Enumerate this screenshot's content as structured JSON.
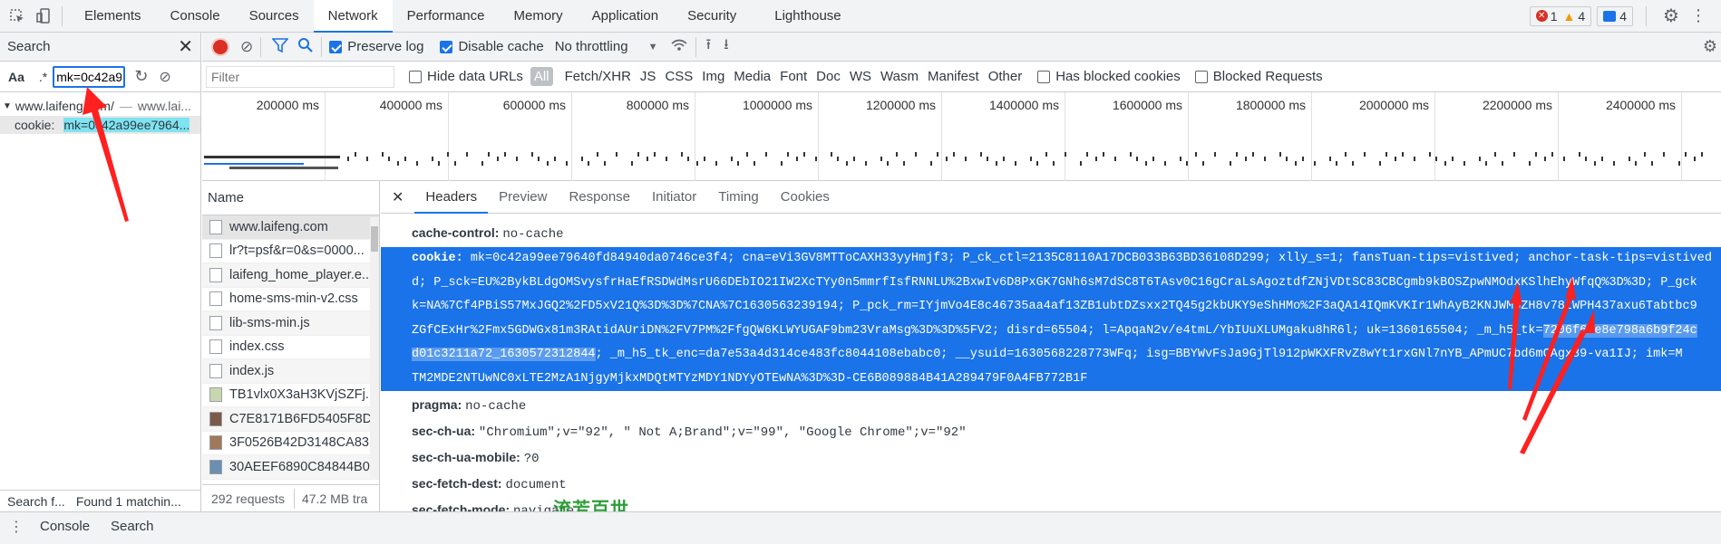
{
  "topbar": {
    "tabs": [
      "Elements",
      "Console",
      "Sources",
      "Network",
      "Performance",
      "Memory",
      "Application",
      "Security",
      "Lighthouse"
    ],
    "active_tab": "Network",
    "errors": "1",
    "warnings": "4",
    "messages": "4"
  },
  "search_panel": {
    "title": "Search",
    "match_case_label": "Aa",
    "regex_label": ".*",
    "query": "mk=0c42a9",
    "result_file": "www.laifeng.com/",
    "result_url": "www.lai...",
    "result_key": "cookie:",
    "result_value": "mk=0c42a99ee7964...",
    "status_left": "Search f...",
    "status_right": "Found 1 matchin..."
  },
  "network_toolbar": {
    "preserve_log": "Preserve log",
    "disable_cache": "Disable cache",
    "throttling": "No throttling"
  },
  "filter_bar": {
    "placeholder": "Filter",
    "hide_data_urls": "Hide data URLs",
    "types": [
      "All",
      "Fetch/XHR",
      "JS",
      "CSS",
      "Img",
      "Media",
      "Font",
      "Doc",
      "WS",
      "Wasm",
      "Manifest",
      "Other"
    ],
    "has_blocked_cookies": "Has blocked cookies",
    "blocked_requests": "Blocked Requests"
  },
  "timeline": {
    "ticks": [
      "200000 ms",
      "400000 ms",
      "600000 ms",
      "800000 ms",
      "1000000 ms",
      "1200000 ms",
      "1400000 ms",
      "1600000 ms",
      "1800000 ms",
      "2000000 ms",
      "2200000 ms",
      "2400000 ms"
    ]
  },
  "request_list": {
    "header": "Name",
    "items": [
      "www.laifeng.com",
      "lr?t=psf&r=0&s=0000...",
      "laifeng_home_player.e...",
      "home-sms-min-v2.css",
      "lib-sms-min.js",
      "index.css",
      "index.js",
      "TB1vlx0X3aH3KVjSZFj...",
      "C7E8171B6FD5405F8D...",
      "3F0526B42D3148CA83...",
      "30AEEF6890C84844B0..."
    ],
    "requests_count": "292 requests",
    "transferred": "47.2 MB tra"
  },
  "detail": {
    "tabs": [
      "Headers",
      "Preview",
      "Response",
      "Initiator",
      "Timing",
      "Cookies"
    ],
    "active_tab": "Headers",
    "cache_control_name": "cache-control:",
    "cache_control_value": "no-cache",
    "cookie_name": "cookie:",
    "cookie_line1": "mk=0c42a99ee79640fd84940da0746ce3f4; cna=eVi3GV8MTToCAXH33yyHmjf3; P_ck_ctl=2135C8110A17DCB033B63BD36108D299; xlly_s=1; fansTuan-tips=vistived; anchor-task-tips=vistived",
    "cookie_line2": "d; P_sck=EU%2BykBLdgOMSvysfrHaEfRSDWdMsrU66DEbIO21IW2XcTYy0n5mmrfIsfRNNLU%2BxwIv6D8PxGK7GNh6sM7dSC8T6TAsv0C16gCraLsAgoztdfZNjVDtSC83CBCgmb9kBOSZpwNMOdxKSlhEhyWfqQ%3D%3D; P_gck",
    "cookie_line3": "k=NA%7Cf4PBiS57MxJGQ2%2FD5xV21Q%3D%3D%7CNA%7C1630563239194; P_pck_rm=IYjmVo4E8c46735aa4af13ZB1ubtDZsxx2TQ45g2kbUKY9eShHMo%2F3aQA14IQmKVKIr1WhAyB2KNJWM3ZH8v78zWPH437axu6Tabtbc9",
    "cookie_line4a": "ZGfCExHr%2Fmx5GDWGx81m3RAtidAUriDN%2FV7PM%2FfgQW6KLWYUGAF9bm23VraMsg%3D%3D%5FV2; disrd=65504; l=ApqaN2v/e4tmL/YbIUuXLUMgaku8hR6l; uk=1360165504; _m_h5_tk=",
    "cookie_line4b": "7206f6ee8e798a6b9f24c",
    "cookie_line5a": "d01c3211a72_1630572312844",
    "cookie_line5b": "; _m_h5_tk_enc=da7e53a4d314ce483fc8044108ebabc0; __ysuid=1630568228773WFq; isg=BBYWvFsJa9GjTl912pWKXFRvZ8wYt1rxGNl7nYB_APmUC7bd6mCAgx39-va1IJ; imk=M",
    "cookie_line6": "TM2MDE2NTUwNC0xLTE2MzA1NjgyMjkxMDQtMTYzMDY1NDYyOTEwNA%3D%3D-CE6B089884B41A289479F0A4FB772B1F",
    "pragma_name": "pragma:",
    "pragma_value": "no-cache",
    "sec_ch_ua_name": "sec-ch-ua:",
    "sec_ch_ua_value": "\"Chromium\";v=\"92\", \" Not A;Brand\";v=\"99\", \"Google Chrome\";v=\"92\"",
    "sec_ch_ua_mobile_name": "sec-ch-ua-mobile:",
    "sec_ch_ua_mobile_value": "?0",
    "sec_fetch_dest_name": "sec-fetch-dest:",
    "sec_fetch_dest_value": "document",
    "sec_fetch_mode_name": "sec-fetch-mode:",
    "sec_fetch_mode_value": "navigate"
  },
  "drawer": {
    "tabs": [
      "Console",
      "Search"
    ]
  },
  "watermark": "流芳百世",
  "colors": {
    "accent": "#1a73e8",
    "record": "#d93025",
    "annotation_arrow": "#ff1f1f"
  }
}
